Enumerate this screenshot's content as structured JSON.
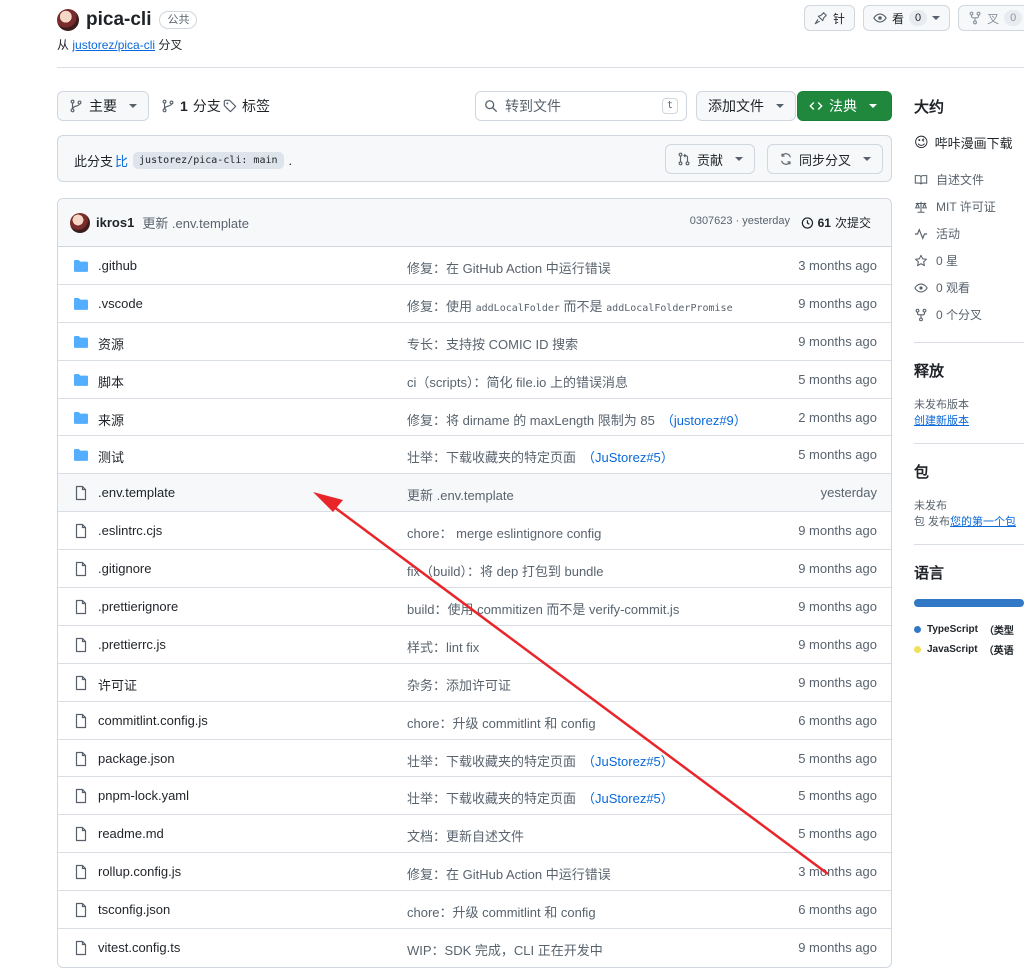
{
  "repo": {
    "name": "pica-cli",
    "visibility": "公共",
    "fork_prefix": "从",
    "fork_source": "justorez/pica-cli",
    "fork_suffix": "分叉"
  },
  "top_actions": {
    "pin_label": "针",
    "watch_label": "看",
    "watch_count": "0",
    "fork_label": "叉",
    "fork_count": "0"
  },
  "toolbar": {
    "branch_label": "主要",
    "branches_count": "1",
    "branches_label": "分支",
    "tags_label": "标签",
    "search_placeholder": "转到文件",
    "search_kbd": "t",
    "add_file_label": "添加文件",
    "code_label": "法典"
  },
  "branch_info": {
    "prefix": "此分支",
    "compare_word": "比",
    "ref": "justorez/pica-cli: main",
    "suffix": ".",
    "contribute_label": "贡献",
    "sync_label": "同步分叉"
  },
  "latest_commit": {
    "author": "ikros1",
    "message": "更新 .env.template",
    "hash_time": "0307623 · yesterday",
    "count": "61",
    "count_label": "次提交"
  },
  "files": [
    {
      "name": ".github",
      "type": "dir",
      "message": "修复：在 GitHub Action 中运行错误",
      "date": "3 months ago"
    },
    {
      "name": ".vscode",
      "type": "dir",
      "message_parts": [
        "修复：使用 ",
        "addLocalFolder",
        " 而不是 ",
        "addLocalFolderPromise"
      ],
      "date": "9 months ago"
    },
    {
      "name": "资源",
      "type": "dir",
      "message": "专长：支持按 COMIC ID 搜索",
      "date": "9 months ago"
    },
    {
      "name": "脚本",
      "type": "dir",
      "message": "ci（scripts）：简化 file.io 上的错误消息",
      "date": "5 months ago"
    },
    {
      "name": "来源",
      "type": "dir",
      "message": "修复：将 dirname 的 maxLength 限制为 85",
      "ref": "（justorez#9）",
      "date": "2 months ago"
    },
    {
      "name": "测试",
      "type": "dir",
      "message": "壮举：下载收藏夹的特定页面",
      "ref": "（JuStorez#5）",
      "date": "5 months ago"
    },
    {
      "name": ".env.template",
      "type": "file",
      "message": "更新 .env.template",
      "date": "yesterday"
    },
    {
      "name": ".eslintrc.cjs",
      "type": "file",
      "message": "chore： merge eslintignore config",
      "date": "9 months ago"
    },
    {
      "name": ".gitignore",
      "type": "file",
      "message": "fix（build）：将 dep 打包到 bundle",
      "date": "9 months ago"
    },
    {
      "name": ".prettierignore",
      "type": "file",
      "message": "build：使用 commitizen 而不是 verify-commit.js",
      "date": "9 months ago"
    },
    {
      "name": ".prettierrc.js",
      "type": "file",
      "message": "样式：lint fix",
      "date": "9 months ago"
    },
    {
      "name": "许可证",
      "type": "file",
      "message": "杂务：添加许可证",
      "date": "9 months ago"
    },
    {
      "name": "commitlint.config.js",
      "type": "file",
      "message": "chore：升级 commitlint 和 config",
      "date": "6 months ago"
    },
    {
      "name": "package.json",
      "type": "file",
      "message": "壮举：下载收藏夹的特定页面",
      "ref": "（JuStorez#5）",
      "date": "5 months ago"
    },
    {
      "name": "pnpm-lock.yaml",
      "type": "file",
      "message": "壮举：下载收藏夹的特定页面",
      "ref": "（JuStorez#5）",
      "date": "5 months ago"
    },
    {
      "name": "readme.md",
      "type": "file",
      "message": "文档：更新自述文件",
      "date": "5 months ago"
    },
    {
      "name": "rollup.config.js",
      "type": "file",
      "message": "修复：在 GitHub Action 中运行错误",
      "date": "3 months ago"
    },
    {
      "name": "tsconfig.json",
      "type": "file",
      "message": "chore：升级 commitlint 和 config",
      "date": "6 months ago"
    },
    {
      "name": "vitest.config.ts",
      "type": "file",
      "message": "WIP：SDK 完成，CLI 正在开发中",
      "date": "9 months ago"
    }
  ],
  "sidebar": {
    "about_title": "大约",
    "about_desc": "哔咔漫画下载",
    "readme": "自述文件",
    "license": "MIT 许可证",
    "activity": "活动",
    "stars": "0 星",
    "watchers": "0 观看",
    "forks": "0 个分叉",
    "releases_title": "释放",
    "releases_none": "未发布版本",
    "releases_create": "创建新版本",
    "packages_title": "包",
    "packages_none": "未发布",
    "packages_prefix": "包 发布",
    "packages_link": "您的第一个包",
    "languages_title": "语言",
    "languages": [
      {
        "name": "TypeScript",
        "detail": "（类型",
        "color": "#3178c6"
      },
      {
        "name": "JavaScript",
        "detail": "（英语",
        "color": "#f1e05a"
      }
    ]
  },
  "colors": {
    "accent": "#0969da",
    "primary_button": "#1f883d",
    "folder_icon": "#54aeff",
    "annotation_arrow": "#e8262a"
  }
}
